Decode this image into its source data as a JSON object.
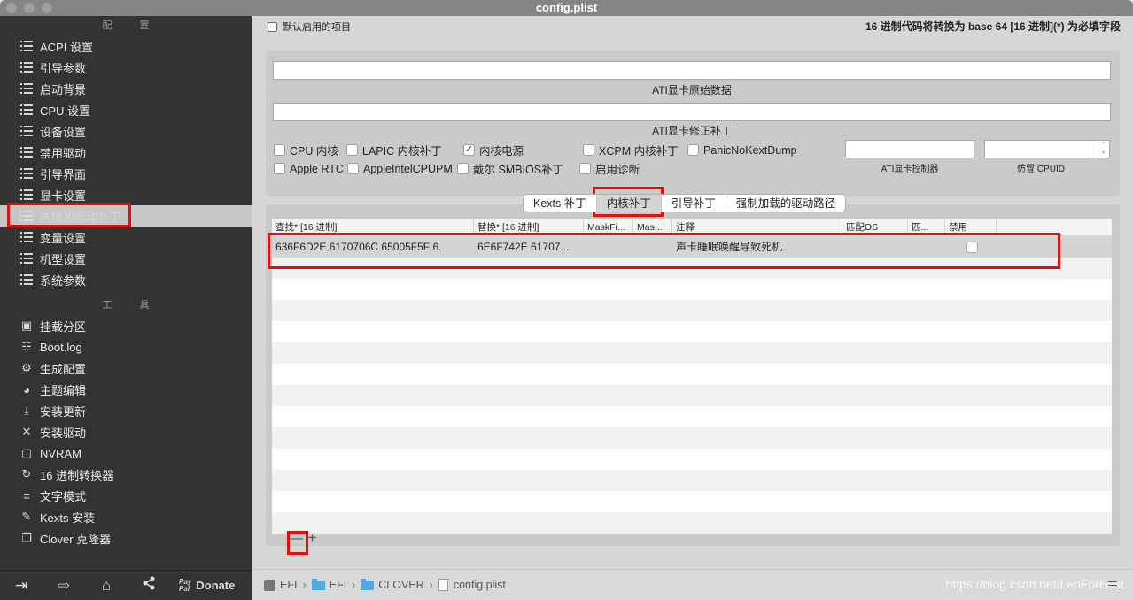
{
  "window": {
    "title": "config.plist"
  },
  "sidebar": {
    "config_section": "配 置",
    "config_items": [
      {
        "label": "ACPI 设置",
        "icon": "list-icon"
      },
      {
        "label": "引导参数",
        "icon": "list-icon"
      },
      {
        "label": "启动背景",
        "icon": "list-icon"
      },
      {
        "label": "CPU 设置",
        "icon": "list-icon"
      },
      {
        "label": "设备设置",
        "icon": "list-icon"
      },
      {
        "label": "禁用驱动",
        "icon": "list-icon"
      },
      {
        "label": "引导界面",
        "icon": "list-icon"
      },
      {
        "label": "显卡设置",
        "icon": "list-icon"
      },
      {
        "label": "内核和驱动补丁",
        "icon": "list-icon",
        "selected": true
      },
      {
        "label": "变量设置",
        "icon": "list-icon"
      },
      {
        "label": "机型设置",
        "icon": "list-icon"
      },
      {
        "label": "系统参数",
        "icon": "list-icon"
      }
    ],
    "tools_section": "工 具",
    "tool_items": [
      {
        "label": "挂载分区",
        "icon": "disk-icon",
        "glyph": "▣"
      },
      {
        "label": "Boot.log",
        "icon": "log-search-icon",
        "glyph": "☷"
      },
      {
        "label": "生成配置",
        "icon": "gears-icon",
        "glyph": "⚙"
      },
      {
        "label": "主题编辑",
        "icon": "palette-icon",
        "glyph": "◕"
      },
      {
        "label": "安装更新",
        "icon": "download-icon",
        "glyph": "⤓"
      },
      {
        "label": "安装驱动",
        "icon": "tools-icon",
        "glyph": "✕"
      },
      {
        "label": "NVRAM",
        "icon": "chip-icon",
        "glyph": "▢"
      },
      {
        "label": "16 进制转换器",
        "icon": "refresh-icon",
        "glyph": "↻"
      },
      {
        "label": "文字模式",
        "icon": "text-lines-icon",
        "glyph": "≡"
      },
      {
        "label": "Kexts 安装",
        "icon": "plug-icon",
        "glyph": "✎"
      },
      {
        "label": "Clover 克隆器",
        "icon": "clone-icon",
        "glyph": "❐"
      }
    ],
    "bottom": {
      "icons": [
        {
          "name": "import-icon",
          "glyph": "⇥"
        },
        {
          "name": "export-icon",
          "glyph": "⇨"
        },
        {
          "name": "home-icon",
          "glyph": "⌂"
        },
        {
          "name": "share-icon",
          "glyph": "<"
        }
      ],
      "paypal_top": "Pay",
      "paypal_bottom": "Pal",
      "donate_label": "Donate"
    }
  },
  "main": {
    "default_items_label": "默认启用的项目",
    "hint": "16 进制代码将转换为 base 64 [16 进制](*) 为必填字段",
    "ati_connectors_data": {
      "value": "",
      "caption": "ATI显卡原始数据"
    },
    "ati_connectors_patch": {
      "value": "",
      "caption": "ATI显卡修正补丁"
    },
    "checkboxes_row1": [
      {
        "label": "CPU 内核",
        "checked": false
      },
      {
        "label": "LAPIC 内核补丁",
        "checked": false
      },
      {
        "label": "内核电源",
        "checked": true
      },
      {
        "label": "XCPM 内核补丁",
        "checked": false
      },
      {
        "label": "PanicNoKextDump",
        "checked": false
      }
    ],
    "checkboxes_row2": [
      {
        "label": "Apple RTC",
        "checked": false
      },
      {
        "label": "AppleIntelCPUPM",
        "checked": false
      },
      {
        "label": "戴尔 SMBIOS补丁",
        "checked": false
      },
      {
        "label": "启用诊断",
        "checked": false
      }
    ],
    "ati_controller": {
      "value": "",
      "caption": "ATI显卡控制器"
    },
    "fake_cpuid": {
      "value": "",
      "caption": "仿冒 CPUID"
    },
    "tabs": [
      {
        "label": "Kexts 补丁",
        "active": false
      },
      {
        "label": "内核补丁",
        "active": true
      },
      {
        "label": "引导补丁",
        "active": false
      },
      {
        "label": "强制加载的驱动路径",
        "active": false
      }
    ],
    "table": {
      "columns": [
        "查找* [16 进制]",
        "替换* [16 进制]",
        "MaskFi...",
        "Mas...",
        "注释",
        "匹配OS",
        "匹...",
        "禁用"
      ],
      "rows": [
        {
          "find": "636F6D2E 6170706C 65005F5F 6...",
          "replace": "6E6F742E 61707...",
          "mask_find": "",
          "mask_replace": "",
          "comment": "声卡睡眠唤醒导致死机",
          "match_os": "",
          "match_build": "",
          "disabled": false
        }
      ]
    },
    "remove_button": "—",
    "add_button": "+"
  },
  "footer": {
    "breadcrumb": [
      "EFI",
      "EFI",
      "CLOVER",
      "config.plist"
    ],
    "watermark": "https://blog.csdn.net/LeoForBest"
  },
  "colors": {
    "sidebar_bg": "#333333",
    "selection": "#c6c6c6",
    "highlight": "#e01010",
    "folder": "#4fa9e3"
  }
}
